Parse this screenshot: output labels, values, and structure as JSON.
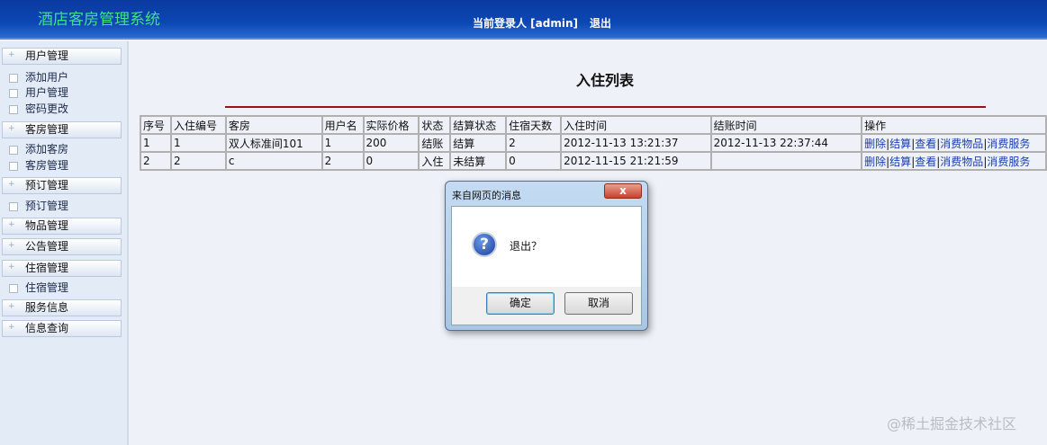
{
  "header": {
    "title": "酒店客房管理系统",
    "user_label": "当前登录人 [admin]",
    "logout": "退出"
  },
  "sidebar": {
    "groups": [
      {
        "label": "用户管理",
        "items": [
          "添加用户",
          "用户管理",
          "密码更改"
        ]
      },
      {
        "label": "客房管理",
        "items": [
          "添加客房",
          "客房管理"
        ]
      },
      {
        "label": "预订管理",
        "items": [
          "预订管理"
        ]
      },
      {
        "label": "物品管理",
        "items": []
      },
      {
        "label": "公告管理",
        "items": []
      },
      {
        "label": "住宿管理",
        "items": [
          "住宿管理"
        ]
      },
      {
        "label": "服务信息",
        "items": []
      },
      {
        "label": "信息查询",
        "items": []
      }
    ]
  },
  "main": {
    "title": "入住列表",
    "columns": [
      "序号",
      "入住编号",
      "客房",
      "用户名",
      "实际价格",
      "状态",
      "结算状态",
      "住宿天数",
      "入住时间",
      "结账时间",
      "操作"
    ],
    "rows": [
      [
        "1",
        "1",
        "双人标准间101",
        "1",
        "200",
        "结账",
        "结算",
        "2",
        "2012-11-13 13:21:37",
        "2012-11-13 22:37:44"
      ],
      [
        "2",
        "2",
        "c",
        "2",
        "0",
        "入住",
        "未结算",
        "0",
        "2012-11-15 21:21:59",
        ""
      ]
    ],
    "actions": [
      "删除",
      "结算",
      "查看",
      "消费物品",
      "消费服务"
    ]
  },
  "dialog": {
    "title": "来自网页的消息",
    "message": "退出？",
    "ok": "确定",
    "cancel": "取消",
    "close": "x"
  },
  "watermark": "@稀土掘金技术社区"
}
